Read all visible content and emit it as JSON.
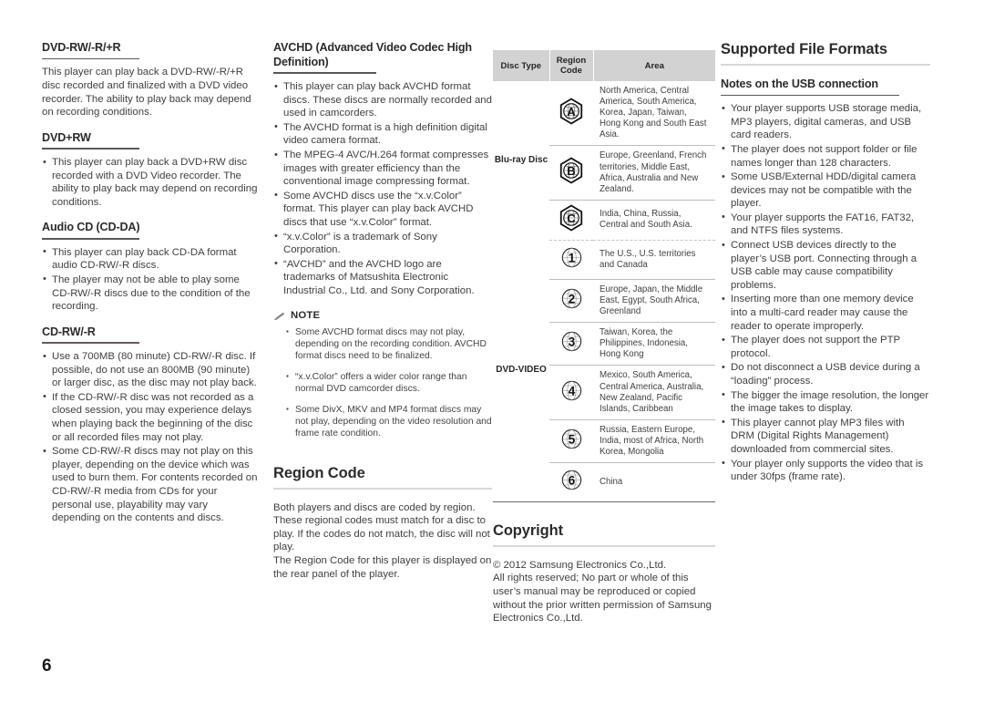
{
  "page": {
    "number": "6"
  },
  "column1": {
    "sections": [
      {
        "heading": "DVD-RW/-R/+R",
        "paragraph": "This player can play back a DVD-RW/-R/+R disc recorded and finalized with a DVD video recorder. The ability to play back may depend on recording conditions."
      },
      {
        "heading": "DVD+RW",
        "bullets": [
          "This player can play back a DVD+RW disc recorded with a DVD Video recorder. The ability to play back may depend on recording conditions."
        ]
      },
      {
        "heading": "Audio CD (CD-DA)",
        "bullets": [
          "This player can play back CD-DA format audio CD-RW/-R discs.",
          "The player may not be able to play some CD-RW/-R discs due to the condition of the recording."
        ]
      },
      {
        "heading": "CD-RW/-R",
        "bullets": [
          "Use a 700MB (80 minute) CD-RW/-R disc. If possible, do not use an 800MB (90 minute) or larger disc, as the disc may not play back.",
          "If the CD-RW/-R disc was not recorded as a closed session, you may experience delays when playing back the beginning of the disc or all recorded files may not play.",
          "Some CD-RW/-R discs may not play on this player, depending on the device which was used to burn them. For contents recorded on CD-RW/-R media from CDs for your personal use, playability may vary depending on the contents and discs."
        ]
      }
    ]
  },
  "column2": {
    "avchd": {
      "heading": "AVCHD (Advanced Video Codec High Definition)",
      "bullets": [
        "This player can play back AVCHD format discs. These discs are normally recorded and used in camcorders.",
        "The AVCHD format is a high definition digital video camera format.",
        "The MPEG-4 AVC/H.264 format compresses images with greater efficiency than the conventional image compressing format.",
        "Some AVCHD discs use the “x.v.Color” format. This player can play back AVCHD discs that use “x.v.Color” format.",
        "“x.v.Color” is a trademark of Sony Corporation.",
        "“AVCHD” and the AVCHD logo are trademarks of Matsushita Electronic Industrial Co., Ltd. and Sony Corporation."
      ]
    },
    "note": {
      "icon": "pencil-note-icon",
      "label": "NOTE",
      "items": [
        "Some AVCHD format discs may not play, depending on the recording condition. AVCHD format discs need to be finalized.",
        "“x.v.Color” offers a wider color range than normal DVD camcorder discs.",
        "Some DivX, MKV and MP4 format discs may not play, depending on the video resolution and frame rate condition."
      ]
    },
    "region_code": {
      "heading": "Region Code",
      "paragraphs": [
        "Both players and discs are coded by region. These regional codes must match for a disc to play. If the codes do not match, the disc will not play.",
        "The Region Code for this player is displayed on the rear panel of the player."
      ]
    }
  },
  "column3": {
    "table": {
      "headers": [
        "Disc Type",
        "Region Code",
        "Area"
      ],
      "groups": [
        {
          "disc_type": "Blu-ray Disc",
          "icon_shape": "hexagon",
          "rows": [
            {
              "code": "A",
              "area": "North America, Central America, South America, Korea, Japan, Taiwan, Hong Kong and South East Asia."
            },
            {
              "code": "B",
              "area": "Europe, Greenland, French territories, Middle East, Africa, Australia and New Zealand."
            },
            {
              "code": "C",
              "area": "India, China, Russia, Central and South Asia."
            }
          ]
        },
        {
          "disc_type": "DVD-VIDEO",
          "icon_shape": "globe",
          "rows": [
            {
              "code": "1",
              "area": "The U.S., U.S. territories and Canada"
            },
            {
              "code": "2",
              "area": "Europe, Japan, the Middle East, Egypt, South Africa, Greenland"
            },
            {
              "code": "3",
              "area": "Taiwan, Korea, the Philippines, Indonesia, Hong Kong"
            },
            {
              "code": "4",
              "area": "Mexico, South America, Central America, Australia, New Zealand, Pacific Islands, Caribbean"
            },
            {
              "code": "5",
              "area": "Russia, Eastern Europe, India, most of Africa, North Korea, Mongolia"
            },
            {
              "code": "6",
              "area": "China"
            }
          ]
        }
      ]
    },
    "copyright": {
      "heading": "Copyright",
      "lines": [
        "© 2012 Samsung Electronics Co.,Ltd.",
        "All rights reserved; No part or whole of this user’s manual may be reproduced or copied without the prior written permission of Samsung Electronics Co.,Ltd."
      ]
    }
  },
  "column4": {
    "heading": "Supported File Formats",
    "subheading": "Notes on the USB connection",
    "bullets": [
      "Your player supports USB storage media, MP3 players, digital cameras, and USB card readers.",
      "The player does not support folder or file names longer than 128 characters.",
      "Some USB/External HDD/digital camera devices may not be compatible with the player.",
      "Your player supports the FAT16, FAT32, and NTFS files systems.",
      "Connect USB devices directly to the player’s USB port. Connecting through a USB cable may cause compatibility problems.",
      "Inserting more than one memory device into a multi-card reader may cause the reader to operate improperly.",
      "The player does not support the PTP protocol.",
      "Do not disconnect a USB device during a “loading” process.",
      "The bigger the image resolution, the longer the image takes to display.",
      "This player cannot play MP3 files with DRM (Digital Rights Management) downloaded from commercial sites.",
      "Your player only supports the video that is under 30fps (frame rate)."
    ]
  },
  "colors": {
    "text": "#3f3f3f",
    "heading": "#2b2b2b",
    "rule_major": "#d8d8d8",
    "rule_minor": "#585858",
    "table_header_bg": "#d2d2d2",
    "table_divider": "#7d4a56"
  }
}
